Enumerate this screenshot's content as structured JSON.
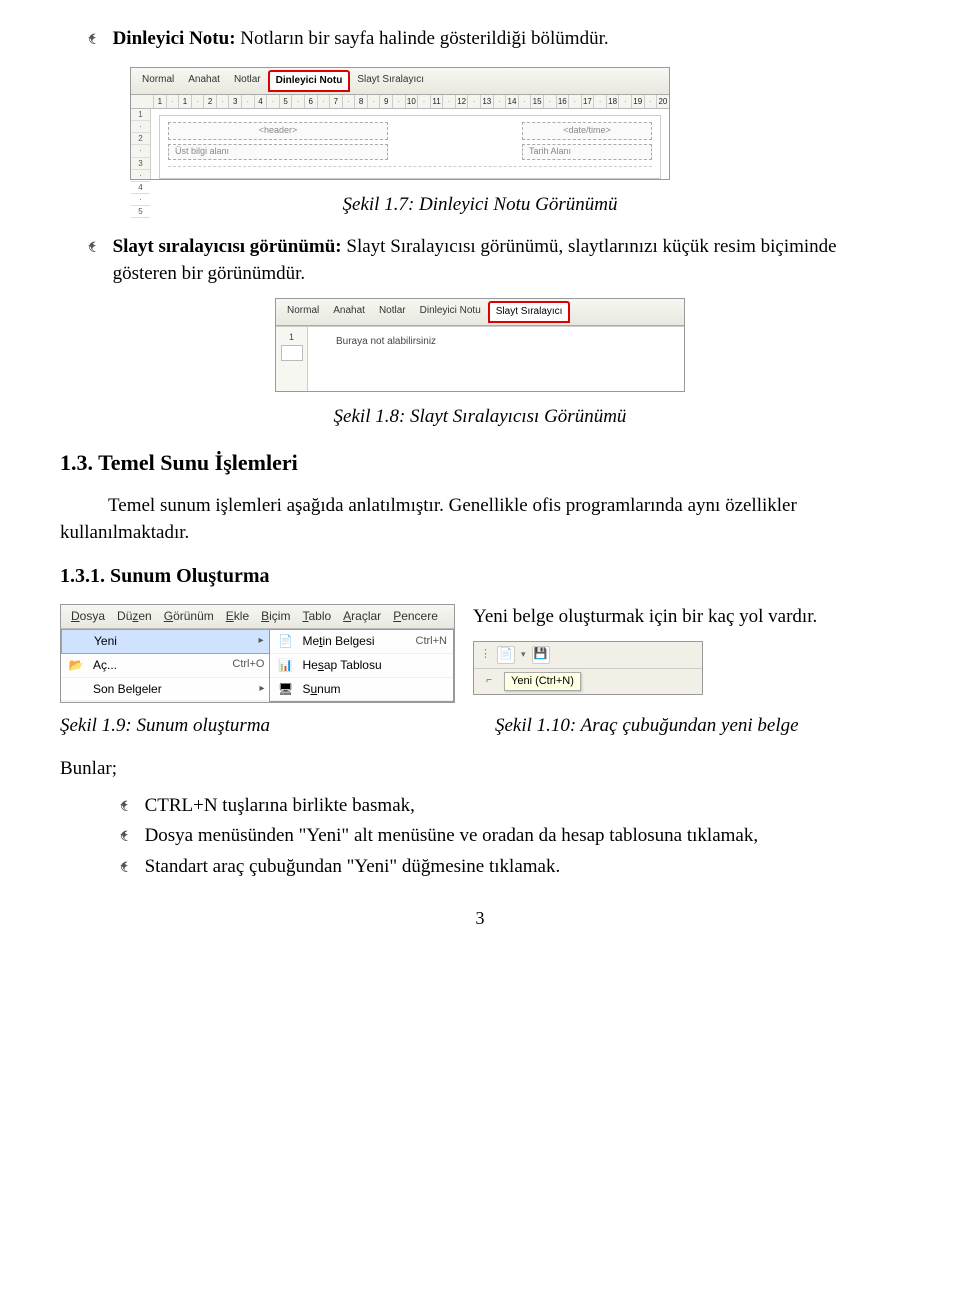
{
  "intro": {
    "label": "Dinleyici Notu:",
    "text": " Notların bir sayfa halinde gösterildiği bölümdür."
  },
  "fig17": {
    "tabs": [
      "Normal",
      "Anahat",
      "Notlar",
      "Dinleyici Notu",
      "Slayt Sıralayıcı"
    ],
    "selected": "Dinleyici Notu",
    "hruler": [
      "1",
      "·",
      "1",
      "·",
      "2",
      "·",
      "3",
      "·",
      "4",
      "·",
      "5",
      "·",
      "6",
      "·",
      "7",
      "·",
      "8",
      "·",
      "9",
      "·",
      "10",
      "·",
      "11",
      "·",
      "12",
      "·",
      "13",
      "·",
      "14",
      "·",
      "15",
      "·",
      "16",
      "·",
      "17",
      "·",
      "18",
      "·",
      "19",
      "·",
      "20"
    ],
    "vruler": [
      "1",
      "·",
      "2",
      "·",
      "3",
      "·",
      "4",
      "·",
      "5"
    ],
    "headerL": "<header>",
    "headerR": "<date/time>",
    "labelL": "Üst bilgi alanı",
    "labelR": "Tarih Alanı",
    "caption": "Şekil 1.7: Dinleyici Notu Görünümü"
  },
  "sec2": {
    "label": "Slayt sıralayıcısı görünümü:",
    "text": " Slayt Sıralayıcısı görünümü, slaytlarınızı küçük resim biçiminde gösteren bir görünümdür."
  },
  "fig18": {
    "tabs": [
      "Normal",
      "Anahat",
      "Notlar",
      "Dinleyici Notu",
      "Slayt Sıralayıcı"
    ],
    "selected": "Slayt Sıralayıcı",
    "slideNum": "1",
    "note": "Buraya not alabilirsiniz",
    "caption": "Şekil 1.8: Slayt Sıralayıcısı Görünümü"
  },
  "h2": "1.3. Temel Sunu İşlemleri",
  "p_temel": "Temel sunum işlemleri aşağıda anlatılmıştır. Genellikle ofis programlarında aynı özellikler kullanılmaktadır.",
  "h3": "1.3.1. Sunum Oluşturma",
  "menu": {
    "bar": [
      "Dosya",
      "Düzen",
      "Görünüm",
      "Ekle",
      "Biçim",
      "Tablo",
      "Araçlar",
      "Pencere"
    ],
    "items": [
      {
        "icon": "",
        "label": "Yeni",
        "shortcut": "",
        "arrow": "▸",
        "sel": true
      },
      {
        "icon": "📂",
        "label": "Aç...",
        "shortcut": "Ctrl+O",
        "arrow": ""
      },
      {
        "icon": "",
        "label": "Son Belgeler",
        "shortcut": "",
        "arrow": "▸"
      }
    ],
    "sub": [
      {
        "icon": "📄",
        "label": "Metin Belgesi",
        "shortcut": "Ctrl+N"
      },
      {
        "icon": "📊",
        "label": "Hesap Tablosu",
        "shortcut": ""
      },
      {
        "icon": "🖥",
        "label": "Sunum",
        "shortcut": ""
      }
    ]
  },
  "right_para": "Yeni belge oluşturmak için bir kaç yol vardır.",
  "tb110": {
    "tooltip": "Yeni (Ctrl+N)"
  },
  "cap19": "Şekil 1.9: Sunum oluşturma",
  "cap110": "Şekil 1.10: Araç çubuğundan yeni belge",
  "bunlar": "Bunlar;",
  "bl1": "CTRL+N tuşlarına birlikte basmak,",
  "bl2": "Dosya menüsünden \"Yeni\" alt menüsüne  ve oradan da hesap tablosuna tıklamak,",
  "bl3": "Standart araç çubuğundan \"Yeni\" düğmesine   tıklamak.",
  "pagenum": "3"
}
